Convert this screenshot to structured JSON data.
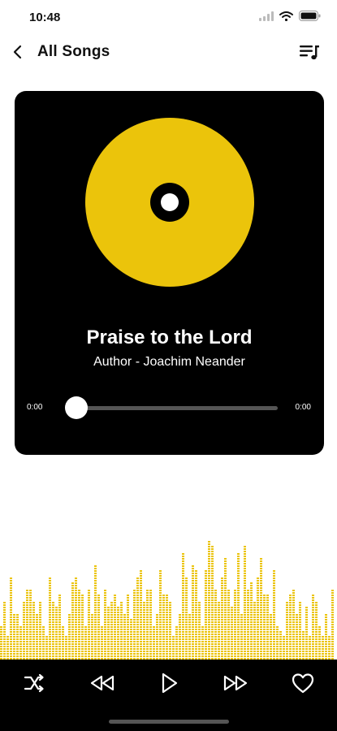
{
  "status_bar": {
    "time": "10:48",
    "icons": [
      "signal-icon",
      "wifi-icon",
      "battery-icon"
    ]
  },
  "nav": {
    "back_icon": "chevron-left-icon",
    "title": "All Songs",
    "queue_icon": "playlist-icon"
  },
  "player": {
    "song_title": "Praise to the Lord",
    "author": "Author - Joachim Neander",
    "elapsed": "0:00",
    "duration": "0:00",
    "progress": 0,
    "disc_icon": "vinyl-disc-icon"
  },
  "colors": {
    "accent": "#EBC40B",
    "card": "#000000",
    "controls_bg": "#000000",
    "track": "#555555",
    "text_light": "#FFFFFF"
  },
  "controls": [
    {
      "name": "shuffle",
      "icon": "shuffle-icon"
    },
    {
      "name": "rewind",
      "icon": "rewind-icon"
    },
    {
      "name": "play",
      "icon": "play-icon"
    },
    {
      "name": "fast-forward",
      "icon": "fast-forward-icon"
    },
    {
      "name": "favorite",
      "icon": "heart-icon"
    }
  ],
  "visualizer": {
    "levels": [
      0.3,
      0.5,
      0.2,
      0.7,
      0.4,
      0.4,
      0.3,
      0.5,
      0.6,
      0.6,
      0.5,
      0.4,
      0.5,
      0.3,
      0.2,
      0.7,
      0.5,
      0.45,
      0.55,
      0.3,
      0.2,
      0.4,
      0.65,
      0.7,
      0.6,
      0.55,
      0.3,
      0.6,
      0.4,
      0.8,
      0.55,
      0.3,
      0.6,
      0.45,
      0.5,
      0.55,
      0.45,
      0.5,
      0.4,
      0.55,
      0.35,
      0.6,
      0.7,
      0.75,
      0.5,
      0.6,
      0.6,
      0.3,
      0.4,
      0.75,
      0.55,
      0.55,
      0.5,
      0.2,
      0.3,
      0.4,
      0.9,
      0.7,
      0.4,
      0.8,
      0.75,
      0.5,
      0.3,
      0.75,
      1.0,
      0.95,
      0.6,
      0.5,
      0.7,
      0.85,
      0.6,
      0.45,
      0.6,
      0.9,
      0.4,
      0.95,
      0.6,
      0.65,
      0.5,
      0.7,
      0.85,
      0.55,
      0.55,
      0.4,
      0.75,
      0.3,
      0.25,
      0.2,
      0.5,
      0.55,
      0.6,
      0.4,
      0.5,
      0.25,
      0.45,
      0.2,
      0.55,
      0.5,
      0.3,
      0.2,
      0.4,
      0.2,
      0.6
    ]
  }
}
